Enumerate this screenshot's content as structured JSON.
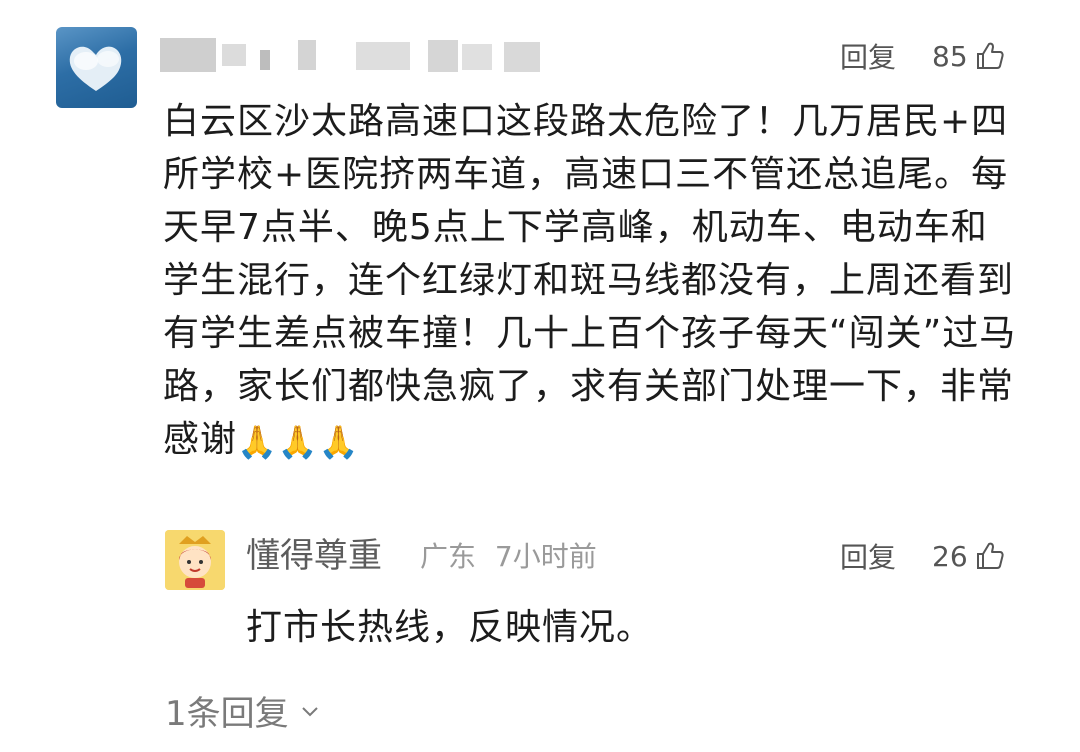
{
  "comment": {
    "avatar_icon": "heart-cloud-avatar",
    "username_visible": false,
    "reply_label": "回复",
    "like_count": "85",
    "text": "白云区沙太路高速口这段路太危险了！几万居民+四所学校+医院挤两车道，高速口三不管还总追尾。每天早7点半、晚5点上下学高峰，机动车、电动车和学生混行，连个红绿灯和斑马线都没有，上周还看到有学生差点被车撞！几十上百个孩子每天“闯关”过马路，家长们都快急疯了，求有关部门处理一下，非常感谢",
    "emoji": "🙏🙏🙏"
  },
  "reply": {
    "username": "懂得尊重",
    "location": "广东",
    "time": "7小时前",
    "reply_label": "回复",
    "like_count": "26",
    "text": "打市长热线，反映情况。"
  },
  "more_replies": {
    "label": "1条回复"
  },
  "colors": {
    "text": "#1c1c1c",
    "meta": "#9a9a9a",
    "action": "#555555",
    "avatar_bg": "#2d6ea6"
  }
}
